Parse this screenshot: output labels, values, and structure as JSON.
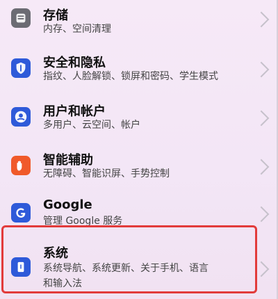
{
  "settings": {
    "items": [
      {
        "title": "存储",
        "subtitle": "内存、空间清理",
        "icon": "storage-icon"
      },
      {
        "title": "安全和隐私",
        "subtitle": "指纹、人脸解锁、锁屏和密码、学生模式",
        "icon": "shield-icon"
      },
      {
        "title": "用户和帐户",
        "subtitle": "多用户、云空间、帐户",
        "icon": "user-icon"
      },
      {
        "title": "智能辅助",
        "subtitle": "无障碍、智能识屏、手势控制",
        "icon": "hand-icon"
      },
      {
        "title": "Google",
        "subtitle": "管理 Google 服务",
        "icon": "google-icon"
      },
      {
        "title": "系统",
        "subtitle_line1": "系统导航、系统更新、关于手机、语言",
        "subtitle_line2": "和输入法",
        "icon": "phone-info-icon"
      }
    ]
  },
  "colors": {
    "storage": "#6b6b73",
    "security": "#2e5ad9",
    "user": "#2e5ad9",
    "assist": "#f05a2a",
    "google": "#2e5ad9",
    "system": "#2e5ad9",
    "highlight": "#e23b3b"
  }
}
